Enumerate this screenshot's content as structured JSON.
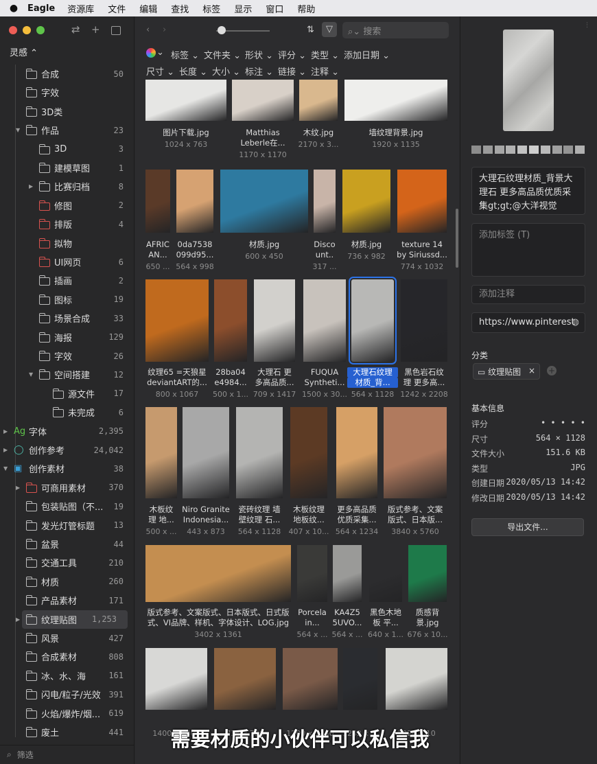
{
  "menubar": {
    "app": "Eagle",
    "items": [
      "资源库",
      "文件",
      "编辑",
      "查找",
      "标签",
      "显示",
      "窗口",
      "帮助"
    ]
  },
  "sidebar": {
    "library": "灵感 ⌃",
    "filter_placeholder": "筛选",
    "items": [
      {
        "label": "合成",
        "count": "50",
        "indent": 1,
        "type": "folder",
        "arrow": false
      },
      {
        "label": "字效",
        "count": "",
        "indent": 1,
        "type": "folder",
        "arrow": false
      },
      {
        "label": "3D类",
        "count": "",
        "indent": 1,
        "type": "folder",
        "arrow": false
      },
      {
        "label": "作品",
        "count": "23",
        "indent": 1,
        "type": "folder",
        "arrow": true,
        "open": true
      },
      {
        "label": "3D",
        "count": "3",
        "indent": 2,
        "type": "folder",
        "arrow": false
      },
      {
        "label": "建模草图",
        "count": "1",
        "indent": 2,
        "type": "folder",
        "arrow": false
      },
      {
        "label": "比赛归档",
        "count": "8",
        "indent": 2,
        "type": "folder",
        "arrow": true
      },
      {
        "label": "修图",
        "count": "2",
        "indent": 2,
        "type": "red",
        "arrow": false
      },
      {
        "label": "排版",
        "count": "4",
        "indent": 2,
        "type": "red",
        "arrow": false
      },
      {
        "label": "拟物",
        "count": "",
        "indent": 2,
        "type": "red",
        "arrow": false
      },
      {
        "label": "UI网页",
        "count": "6",
        "indent": 2,
        "type": "red",
        "arrow": false
      },
      {
        "label": "插画",
        "count": "2",
        "indent": 2,
        "type": "folder",
        "arrow": false
      },
      {
        "label": "图标",
        "count": "19",
        "indent": 2,
        "type": "folder",
        "arrow": false
      },
      {
        "label": "场景合成",
        "count": "33",
        "indent": 2,
        "type": "folder",
        "arrow": false
      },
      {
        "label": "海报",
        "count": "129",
        "indent": 2,
        "type": "folder",
        "arrow": false
      },
      {
        "label": "字效",
        "count": "26",
        "indent": 2,
        "type": "folder",
        "arrow": false
      },
      {
        "label": "空间搭建",
        "count": "12",
        "indent": 2,
        "type": "folder",
        "arrow": true,
        "open": true
      },
      {
        "label": "源文件",
        "count": "17",
        "indent": 3,
        "type": "folder",
        "arrow": false
      },
      {
        "label": "未完成",
        "count": "6",
        "indent": 3,
        "type": "folder",
        "arrow": false
      },
      {
        "label": "字体",
        "count": "2,395",
        "indent": 0,
        "type": "ag",
        "arrow": true
      },
      {
        "label": "创作参考",
        "count": "24,042",
        "indent": 0,
        "type": "bulb",
        "arrow": true
      },
      {
        "label": "创作素材",
        "count": "38",
        "indent": 0,
        "type": "img",
        "arrow": true,
        "open": true
      },
      {
        "label": "可商用素材",
        "count": "370",
        "indent": 1,
        "type": "red",
        "arrow": true
      },
      {
        "label": "包装贴图（不...",
        "count": "19",
        "indent": 1,
        "type": "folder",
        "arrow": false
      },
      {
        "label": "发光灯管标题",
        "count": "13",
        "indent": 1,
        "type": "folder",
        "arrow": false
      },
      {
        "label": "盆景",
        "count": "44",
        "indent": 1,
        "type": "folder",
        "arrow": false
      },
      {
        "label": "交通工具",
        "count": "210",
        "indent": 1,
        "type": "folder",
        "arrow": false
      },
      {
        "label": "材质",
        "count": "260",
        "indent": 1,
        "type": "folder",
        "arrow": false
      },
      {
        "label": "产品素材",
        "count": "171",
        "indent": 1,
        "type": "folder",
        "arrow": false
      },
      {
        "label": "纹理贴图",
        "count": "1,253",
        "indent": 1,
        "type": "folder",
        "arrow": true,
        "selected": true
      },
      {
        "label": "风景",
        "count": "427",
        "indent": 1,
        "type": "folder",
        "arrow": false
      },
      {
        "label": "合成素材",
        "count": "808",
        "indent": 1,
        "type": "folder",
        "arrow": false
      },
      {
        "label": "冰、水、海",
        "count": "161",
        "indent": 1,
        "type": "folder",
        "arrow": false
      },
      {
        "label": "闪电/粒子/光效",
        "count": "391",
        "indent": 1,
        "type": "folder",
        "arrow": false
      },
      {
        "label": "火焰/爆炸/烟...",
        "count": "619",
        "indent": 1,
        "type": "folder",
        "arrow": false
      },
      {
        "label": "废土",
        "count": "441",
        "indent": 1,
        "type": "folder",
        "arrow": false
      }
    ]
  },
  "toolbar": {
    "search_placeholder": "搜索"
  },
  "filters": {
    "row1": [
      "标签 ⌄",
      "文件夹 ⌄",
      "形状 ⌄",
      "评分 ⌄",
      "类型 ⌄",
      "添加日期 ⌄"
    ],
    "row2": [
      "尺寸 ⌄",
      "长度 ⌄",
      "大小 ⌄",
      "标注 ⌄",
      "链接 ⌄",
      "注释 ⌄"
    ]
  },
  "grid": [
    {
      "name": "图片下载.jpg",
      "dims": "1024 x 763",
      "color": "#e6e6e4"
    },
    {
      "name": "Matthias|Leberle在...",
      "dims": "1170 x 1170",
      "color": "#d8d0c8"
    },
    {
      "name": "木纹.jpg",
      "dims": "2170 x 3...",
      "color": "#d9b88e"
    },
    {
      "name": "墙纹理背景.jpg",
      "dims": "1920 x 1135",
      "color": "#eeeeec"
    },
    {
      "name": "AFRIC|AN...",
      "dims": "650 ...",
      "color": "#5a3a28"
    },
    {
      "name": "0da7538|099d95...",
      "dims": "564 x 998",
      "color": "#d6a272"
    },
    {
      "name": "材质.jpg",
      "dims": "600 x 450",
      "color": "#2e7aa0"
    },
    {
      "name": "Disco|unt..",
      "dims": "317 ...",
      "color": "#c8b4a8"
    },
    {
      "name": "材质.jpg",
      "dims": "736 x 982",
      "color": "#c9a020"
    },
    {
      "name": "texture 14|by Siriussd...",
      "dims": "774 x 1032",
      "color": "#d4641a"
    },
    {
      "name": "纹理65 =天狼星|deviantART的...",
      "dims": "800 x 1067",
      "color": "#c06a1e"
    },
    {
      "name": "28ba04|e4984...",
      "dims": "500 x 1...",
      "color": "#8c4e2c"
    },
    {
      "name": "大理石 更|多高品质...",
      "dims": "709 x 1417",
      "color": "#d2d0cc"
    },
    {
      "name": "FUQUA|Syntheti...",
      "dims": "1500 x 30...",
      "color": "#c8c2bc"
    },
    {
      "name": "大理石纹理|材质_背...",
      "dims": "564 x 1128",
      "color": "#b8b8b6",
      "selected": true
    },
    {
      "name": "黑色岩石纹|理 更多高...",
      "dims": "1242 x 2208",
      "color": "#26262a"
    },
    {
      "name": "木板纹|理 地...",
      "dims": "500 x ...",
      "color": "#c69a6e"
    },
    {
      "name": "Niro Granite|Indonesia...",
      "dims": "443 x 873",
      "color": "#a8a8a8"
    },
    {
      "name": "瓷砖纹理 墙|壁纹理 石...",
      "dims": "564 x 1128",
      "color": "#b4b4b2"
    },
    {
      "name": "木板纹理|地板纹...",
      "dims": "407 x 10...",
      "color": "#5c3a24"
    },
    {
      "name": "更多高品质|优质采集...",
      "dims": "564 x 1234",
      "color": "#d6a066"
    },
    {
      "name": "版式参考、文案|版式、日本版...",
      "dims": "3840 x 5760",
      "color": "#b07a5e"
    },
    {
      "name": "版式参考、文案版式、日本版式、日式版|式、VI品牌、样机、字体设计、LOG.jpg",
      "dims": "3402 x 1361",
      "color": "#c48e50"
    },
    {
      "name": "Porcela|in...",
      "dims": "564 x ...",
      "color": "#3a3a38"
    },
    {
      "name": "KA4Z5|5UVO...",
      "dims": "564 x ...",
      "color": "#9a9a98"
    },
    {
      "name": "黑色木地|板 平...",
      "dims": "640 x 1...",
      "color": "#2c2c2e"
    },
    {
      "name": "质感背|景.jpg",
      "dims": "676 x 10...",
      "color": "#1e7a4a"
    },
    {
      "name": "",
      "dims": "1400 x 1400",
      "color": "#d8d8d6"
    },
    {
      "name": "",
      "dims": "736 x 736",
      "color": "#8a6240"
    },
    {
      "name": "",
      "dims": "1200 x 1340",
      "color": "#7a5a48"
    },
    {
      "name": "",
      "dims": "1242 x ...",
      "color": "#2a2c30"
    },
    {
      "name": "",
      "dims": "1024 x 10",
      "color": "#d4d4d0"
    }
  ],
  "subtitle": "需要材质的小伙伴可以私信我",
  "inspector": {
    "title": "大理石纹理材质_背景大理石 更多高品质优质采集gt;gt;@大洋视觉",
    "tags_placeholder": "添加标签 (T)",
    "note_placeholder": "添加注释",
    "url": "https://www.pinterest",
    "folder_header": "分类",
    "folder_chip": "纹理贴图",
    "info_header": "基本信息",
    "info": [
      {
        "k": "评分",
        "v": "• • • • •"
      },
      {
        "k": "尺寸",
        "v": "564 × 1128"
      },
      {
        "k": "文件大小",
        "v": "151.6 KB"
      },
      {
        "k": "类型",
        "v": "JPG"
      },
      {
        "k": "创建日期",
        "v": "2020/05/13 14:42"
      },
      {
        "k": "修改日期",
        "v": "2020/05/13 14:42"
      }
    ],
    "export_label": "导出文件...",
    "palette": [
      "#8c8c8c",
      "#9a9a9a",
      "#a6a6a6",
      "#b2b2b2",
      "#c2c2c2",
      "#cecece",
      "#bababa",
      "#a0a0a0",
      "#949494",
      "#b0b0b0"
    ]
  }
}
